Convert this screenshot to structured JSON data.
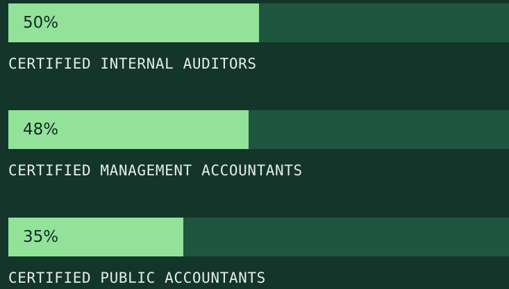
{
  "colors": {
    "background": "#14352a",
    "track": "#1e5640",
    "fill": "#92e29a",
    "percent_text": "#0f2a20",
    "label_text": "#e6ece8"
  },
  "stats": [
    {
      "percent_label": "50%",
      "value_fraction": 0.5,
      "label": "CERTIFIED INTERNAL AUDITORS"
    },
    {
      "percent_label": "48%",
      "value_fraction": 0.48,
      "label": "CERTIFIED MANAGEMENT ACCOUNTANTS"
    },
    {
      "percent_label": "35%",
      "value_fraction": 0.35,
      "label": "CERTIFIED PUBLIC ACCOUNTANTS"
    }
  ]
}
